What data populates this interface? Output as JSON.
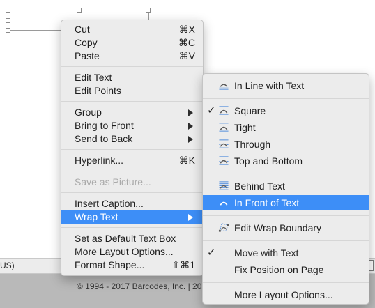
{
  "status_bar": {
    "language": "US)"
  },
  "footer": {
    "copyright": "© 1994 - 2017 Barcodes, Inc. | 20"
  },
  "context_menu": {
    "groups": [
      [
        {
          "label": "Cut",
          "shortcut": "⌘X"
        },
        {
          "label": "Copy",
          "shortcut": "⌘C"
        },
        {
          "label": "Paste",
          "shortcut": "⌘V"
        }
      ],
      [
        {
          "label": "Edit Text"
        },
        {
          "label": "Edit Points"
        }
      ],
      [
        {
          "label": "Group",
          "submenu": true
        },
        {
          "label": "Bring to Front",
          "submenu": true
        },
        {
          "label": "Send to Back",
          "submenu": true
        }
      ],
      [
        {
          "label": "Hyperlink...",
          "shortcut": "⌘K"
        }
      ],
      [
        {
          "label": "Save as Picture...",
          "disabled": true
        }
      ],
      [
        {
          "label": "Insert Caption..."
        },
        {
          "label": "Wrap Text",
          "submenu": true,
          "highlighted": true
        }
      ],
      [
        {
          "label": "Set as Default Text Box"
        },
        {
          "label": "More Layout Options..."
        },
        {
          "label": "Format Shape...",
          "shortcut": "⇧⌘1"
        }
      ]
    ]
  },
  "wrap_menu": {
    "groups": [
      [
        {
          "label": "In Line with Text",
          "icon": "inline-wrap-icon"
        }
      ],
      [
        {
          "label": "Square",
          "icon": "square-wrap-icon",
          "checked": true
        },
        {
          "label": "Tight",
          "icon": "tight-wrap-icon"
        },
        {
          "label": "Through",
          "icon": "through-wrap-icon"
        },
        {
          "label": "Top and Bottom",
          "icon": "top-bottom-wrap-icon"
        }
      ],
      [
        {
          "label": "Behind Text",
          "icon": "behind-text-icon"
        },
        {
          "label": "In Front of Text",
          "icon": "in-front-text-icon",
          "highlighted": true
        }
      ],
      [
        {
          "label": "Edit Wrap Boundary",
          "icon": "edit-wrap-boundary-icon"
        }
      ],
      [
        {
          "label": "Move with Text",
          "checked": true
        },
        {
          "label": "Fix Position on Page"
        }
      ],
      [
        {
          "label": "More Layout Options..."
        }
      ]
    ]
  },
  "colors": {
    "highlight": "#3d8ef7",
    "menu_background": "#ececec",
    "disabled_text": "#aaaaaa"
  }
}
